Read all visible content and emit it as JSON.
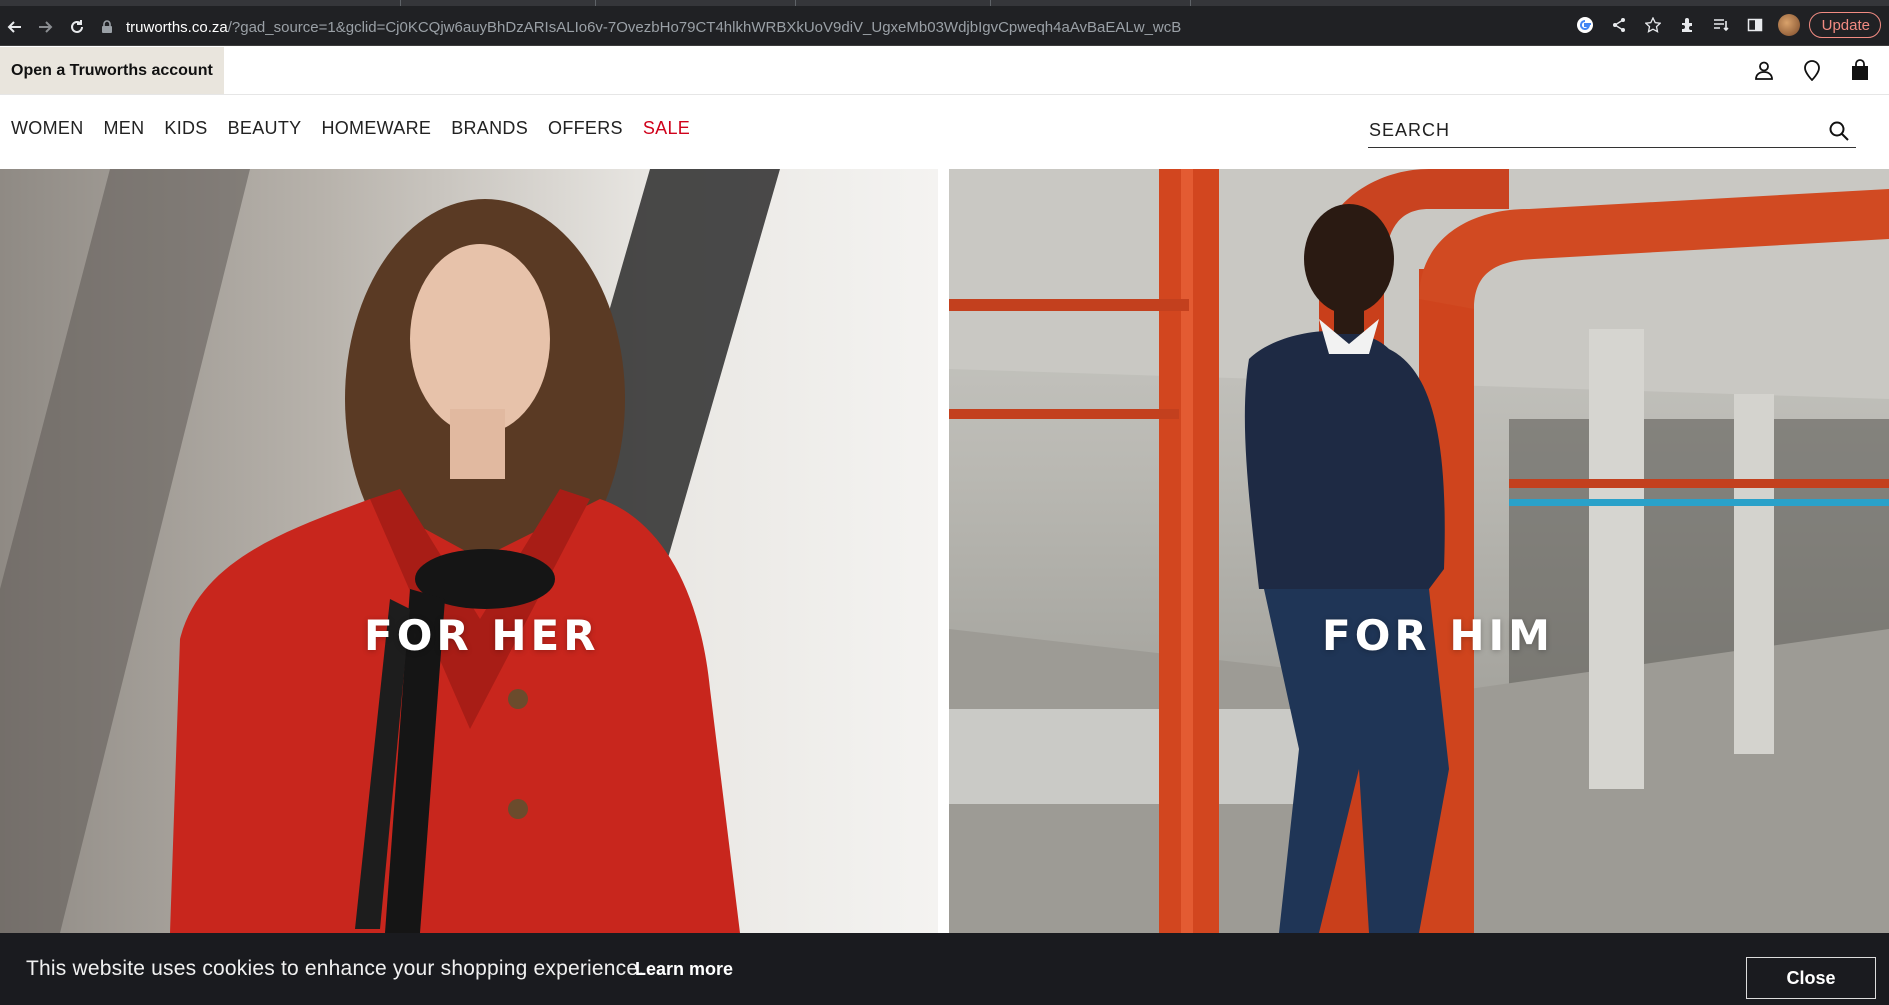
{
  "browser": {
    "url_host": "truworths.co.za",
    "url_rest": "/?gad_source=1&gclid=Cj0KCQjw6auyBhDzARIsALIo6v-7OvezbHo79CT4hlkhWRBXkUoV9diV_UgxeMb03WdjbIgvCpweqh4aAvBaEALw_wcB",
    "update_label": "Update"
  },
  "topbar": {
    "account_label": "Open a Truworths account"
  },
  "nav": {
    "items": [
      "WOMEN",
      "MEN",
      "KIDS",
      "BEAUTY",
      "HOMEWARE",
      "BRANDS",
      "OFFERS",
      "SALE"
    ],
    "search_placeholder": "SEARCH"
  },
  "hero": {
    "her_title": "FOR HER",
    "him_title": "FOR HIM"
  },
  "cookie": {
    "message": "This website uses cookies to enhance your shopping experience.",
    "learn_more": "Learn more",
    "close_label": "Close"
  },
  "colors": {
    "sale": "#d0021b",
    "account_bg": "#e9e5dd",
    "cookie_bg": "#1a1b1f",
    "chrome_bg": "#202124"
  }
}
